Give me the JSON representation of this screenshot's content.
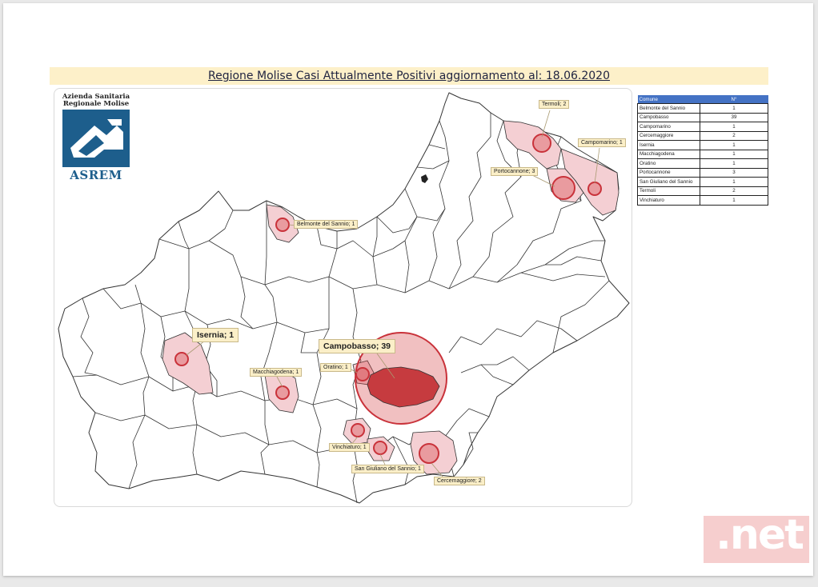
{
  "title": "Regione Molise Casi Attualmente Positivi aggiornamento al: 18.06.2020",
  "logo": {
    "line1": "Azienda Sanitaria",
    "line2": "Regionale Molise",
    "name": "ASREM"
  },
  "table": {
    "headers": [
      "Comune",
      "N°"
    ],
    "rows": [
      {
        "comune": "Belmonte del Sannio",
        "n": "1"
      },
      {
        "comune": "Campobasso",
        "n": "39"
      },
      {
        "comune": "Campomarino",
        "n": "1"
      },
      {
        "comune": "Cercemaggiore",
        "n": "2"
      },
      {
        "comune": "Isernia",
        "n": "1"
      },
      {
        "comune": "Macchiagodena",
        "n": "1"
      },
      {
        "comune": "Oratino",
        "n": "1"
      },
      {
        "comune": "Portocannone",
        "n": "3"
      },
      {
        "comune": "San Giuliano del Sannio",
        "n": "1"
      },
      {
        "comune": "Termoli",
        "n": "2"
      },
      {
        "comune": "Vinchiaturo",
        "n": "1"
      }
    ]
  },
  "map_labels": {
    "termoli": "Termoli; 2",
    "campomarino": "Campomarino; 1",
    "portocannone": "Portocannone; 3",
    "belmonte": "Belmonte del Sannio; 1",
    "isernia": "Isernia; 1",
    "campobasso": "Campobasso; 39",
    "oratino": "Oratino; 1",
    "macchiagodena": "Macchiagodena; 1",
    "vinchiaturo": "Vinchiaturo; 1",
    "san_giuliano": "San Giuliano del Sannio; 1",
    "cercemaggiore": "Cercemaggiore; 2"
  },
  "colors": {
    "highlight_fill": "#f4cfd3",
    "campobasso_fill": "#c63b3f",
    "bubble": "#d33a3f",
    "header_blue": "#4472c4"
  },
  "watermark": ".net"
}
